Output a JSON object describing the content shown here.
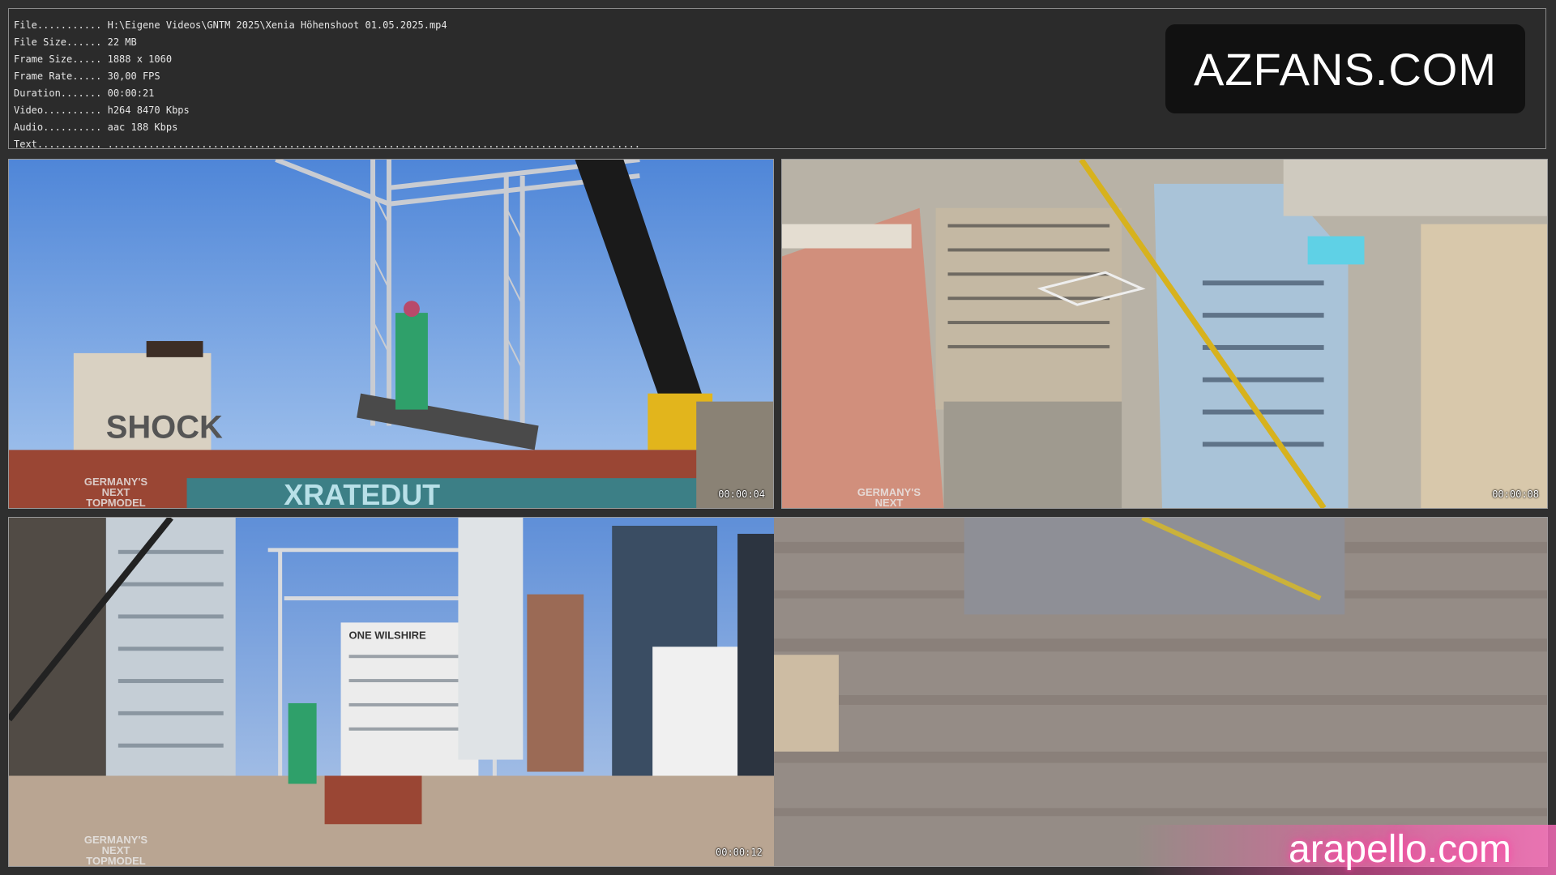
{
  "info": {
    "lines": [
      "File........... H:\\Eigene Videos\\GNTM 2025\\Xenia Höhenshoot 01.05.2025.mp4",
      "File Size...... 22 MB",
      "Frame Size..... 1888 x 1060",
      "Frame Rate..... 30,00 FPS",
      "Duration....... 00:00:21",
      "Video.......... h264 8470 Kbps",
      "Audio.......... aac 188 Kbps",
      "Text........... ..........................................................................................."
    ]
  },
  "logo": {
    "text": "AZFANS.COM"
  },
  "frames": [
    {
      "timestamp": "00:00:04",
      "brand": "GERMANY'S\nNEXT\nTOPMODEL"
    },
    {
      "timestamp": "00:00:08",
      "brand": "GERMANY'S\nNEXT"
    },
    {
      "timestamp": "00:00:12",
      "brand": "GERMANY'S\nNEXT\nTOPMODEL"
    }
  ],
  "scene_text": {
    "graffiti_wall": "XRATEDUT",
    "graffiti_chimney": "SHOCK",
    "building_sign": "ONE WILSHIRE"
  },
  "watermark": {
    "text": "arapello.com"
  }
}
